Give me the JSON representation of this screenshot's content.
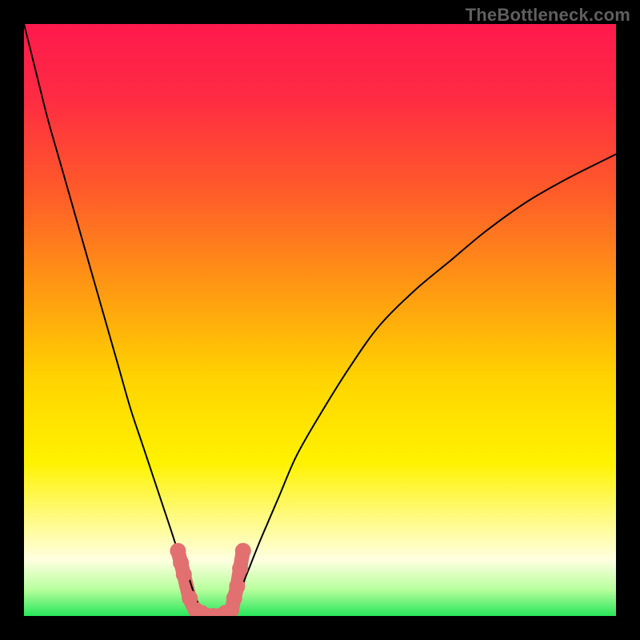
{
  "watermark": "TheBottleneck.com",
  "colors": {
    "frame": "#000000",
    "gradient_stops": [
      {
        "offset": 0.0,
        "color": "#ff1a4d"
      },
      {
        "offset": 0.12,
        "color": "#ff2a44"
      },
      {
        "offset": 0.28,
        "color": "#ff5a2a"
      },
      {
        "offset": 0.45,
        "color": "#ff9a12"
      },
      {
        "offset": 0.6,
        "color": "#ffd400"
      },
      {
        "offset": 0.74,
        "color": "#fff200"
      },
      {
        "offset": 0.84,
        "color": "#fffb8a"
      },
      {
        "offset": 0.905,
        "color": "#ffffe0"
      },
      {
        "offset": 0.955,
        "color": "#b8ff9e"
      },
      {
        "offset": 1.0,
        "color": "#28e65a"
      }
    ],
    "curve": "#000000",
    "marker": "#e27070"
  },
  "chart_data": {
    "type": "line",
    "title": "",
    "xlabel": "",
    "ylabel": "",
    "xlim": [
      0,
      100
    ],
    "ylim": [
      0,
      100
    ],
    "series": [
      {
        "name": "left-curve",
        "x": [
          0,
          2,
          4,
          6,
          8,
          10,
          12,
          14,
          16,
          18,
          20,
          22,
          24,
          25,
          26,
          27,
          28,
          29,
          30
        ],
        "y": [
          100,
          92,
          84,
          77,
          70,
          63,
          56,
          49,
          42,
          35,
          29,
          23,
          17,
          14,
          11,
          9,
          6,
          3,
          1
        ]
      },
      {
        "name": "right-curve",
        "x": [
          35,
          36,
          38,
          40,
          43,
          46,
          50,
          55,
          60,
          66,
          72,
          78,
          85,
          92,
          100
        ],
        "y": [
          1,
          3,
          8,
          13,
          20,
          27,
          34,
          42,
          49,
          55,
          60,
          65,
          70,
          74,
          78
        ]
      },
      {
        "name": "bottom-flat",
        "x": [
          30,
          31,
          32,
          33,
          34,
          35
        ],
        "y": [
          1,
          0,
          0,
          0,
          0,
          1
        ]
      }
    ],
    "markers": {
      "name": "highlight-dots",
      "color": "#e27070",
      "points": [
        {
          "x": 26.0,
          "y": 11.0
        },
        {
          "x": 26.5,
          "y": 9.0
        },
        {
          "x": 27.0,
          "y": 7.0
        },
        {
          "x": 28.0,
          "y": 3.0
        },
        {
          "x": 29.0,
          "y": 1.0
        },
        {
          "x": 30.0,
          "y": 0.5
        },
        {
          "x": 31.0,
          "y": 0.0
        },
        {
          "x": 32.0,
          "y": 0.0
        },
        {
          "x": 33.0,
          "y": 0.0
        },
        {
          "x": 34.0,
          "y": 0.5
        },
        {
          "x": 35.0,
          "y": 1.0
        },
        {
          "x": 35.5,
          "y": 3.0
        },
        {
          "x": 36.0,
          "y": 5.0
        },
        {
          "x": 36.5,
          "y": 8.0
        },
        {
          "x": 37.0,
          "y": 11.0
        }
      ]
    }
  }
}
